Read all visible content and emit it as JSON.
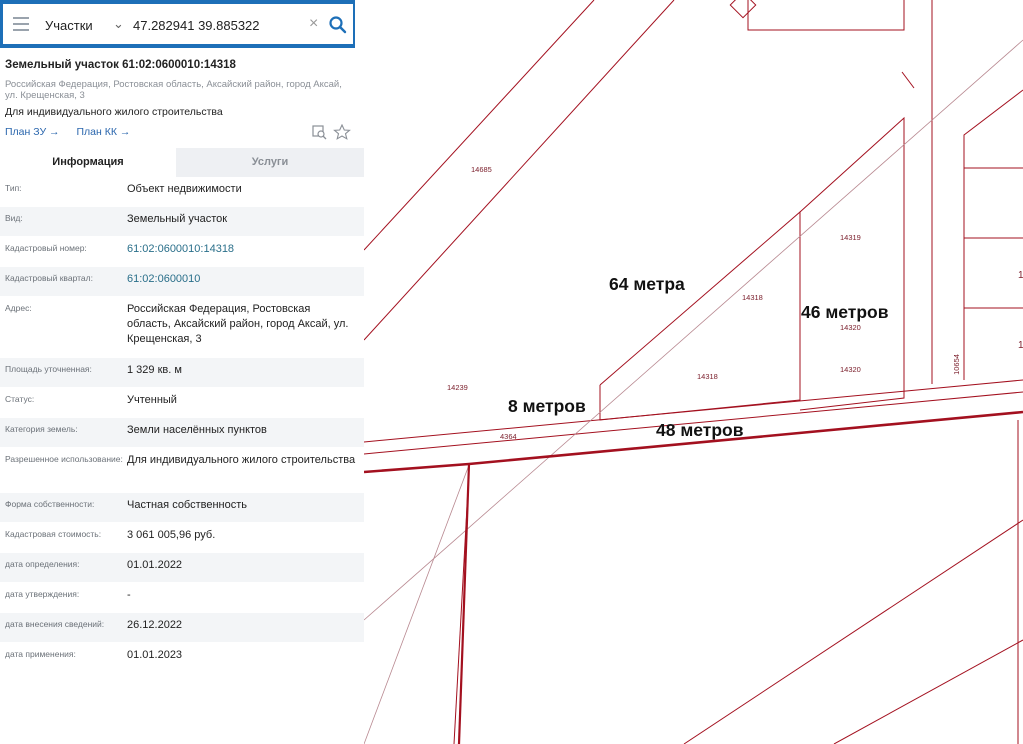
{
  "search": {
    "layer": "Участки",
    "query": "47.282941 39.885322"
  },
  "panel": {
    "title": "Земельный участок 61:02:0600010:14318",
    "address": "Российская Федерация, Ростовская область, Аксайский район, город Аксай, ул. Крещенская, 3",
    "purpose": "Для индивидуального жилого строительства",
    "links": [
      "План ЗУ →",
      "План КК →"
    ],
    "tabs": [
      "Информация",
      "Услуги"
    ],
    "rows": [
      {
        "label": "Тип:",
        "value": "Объект недвижимости"
      },
      {
        "label": "Вид:",
        "value": "Земельный участок"
      },
      {
        "label": "Кадастровый номер:",
        "value": "61:02:0600010:14318"
      },
      {
        "label": "Кадастровый квартал:",
        "value": "61:02:0600010"
      },
      {
        "label": "Адрес:",
        "value": "Российская Федерация, Ростовская область, Аксайский район, город Аксай, ул. Крещенская, 3"
      },
      {
        "label": "Площадь уточненная:",
        "value": "1 329 кв. м"
      },
      {
        "label": "Статус:",
        "value": "Учтенный"
      },
      {
        "label": "Категория земель:",
        "value": "Земли населённых пунктов"
      },
      {
        "label": "Разрешенное использование:",
        "value": "Для индивидуального жилого строительства"
      },
      {
        "label": "Форма собственности:",
        "value": "Частная собственность"
      },
      {
        "label": "Кадастровая стоимость:",
        "value": "3 061 005,96 руб."
      },
      {
        "label": "дата определения:",
        "value": "01.01.2022"
      },
      {
        "label": "дата утверждения:",
        "value": "-"
      },
      {
        "label": "дата внесения сведений:",
        "value": "26.12.2022"
      },
      {
        "label": "дата применения:",
        "value": "01.01.2023"
      }
    ]
  },
  "map": {
    "measurements": [
      "64 метра",
      "46 метров",
      "8 метров",
      "48 метров"
    ],
    "plot_numbers": [
      "14685",
      "14319",
      "14318",
      "14320",
      "14318",
      "14320",
      "14239",
      "4364",
      "10654",
      "1",
      "1"
    ]
  },
  "colors": {
    "header": "#1d6fb8",
    "boundary": "#a3101f",
    "link": "#2a66ad"
  }
}
